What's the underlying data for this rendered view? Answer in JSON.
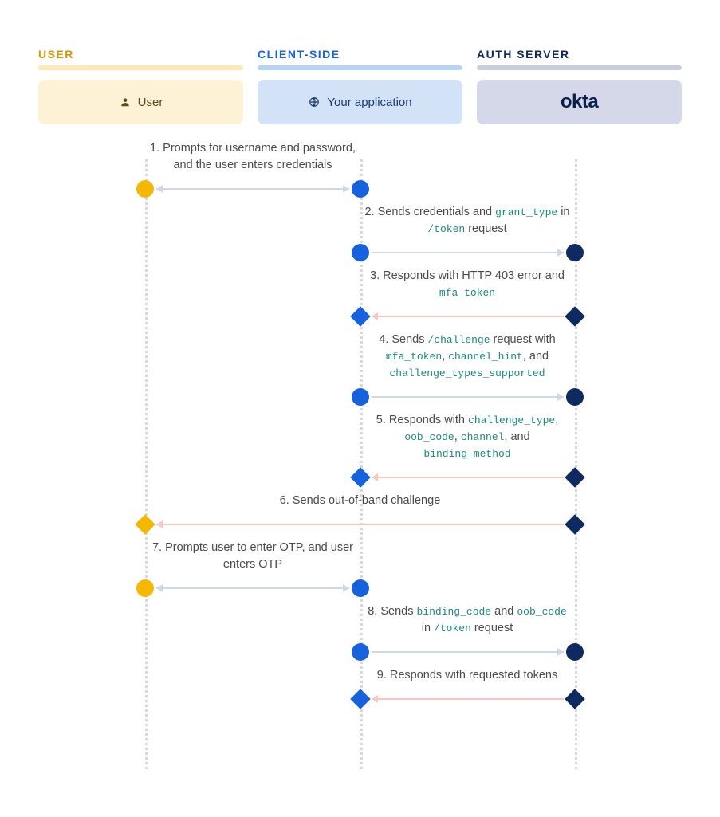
{
  "columns": {
    "user": {
      "header": "USER",
      "box_label": "User"
    },
    "client": {
      "header": "CLIENT-SIDE",
      "box_label": "Your application"
    },
    "server": {
      "header": "AUTH SERVER",
      "box_label": "okta"
    }
  },
  "steps": {
    "s1": {
      "pre": "1. Prompts for username and password, and the user enters credentials"
    },
    "s2": {
      "pre": "2. Sends credentials and ",
      "c1": "grant_type",
      "mid": " in ",
      "c2": "/token",
      "post": " request"
    },
    "s3": {
      "pre": "3. Responds with HTTP 403 error and ",
      "c1": "mfa_token"
    },
    "s4": {
      "pre": "4. Sends ",
      "c1": "/challenge",
      "mid1": " request with ",
      "c2": "mfa_token",
      "mid2": ", ",
      "c3": "channel_hint",
      "mid3": ", and ",
      "c4": "challenge_types_supported"
    },
    "s5": {
      "pre": "5. Responds with ",
      "c1": "challenge_type",
      "mid1": ", ",
      "c2": "oob_code",
      "mid2": ", ",
      "c3": "channel",
      "mid3": ", and ",
      "c4": "binding_method"
    },
    "s6": {
      "pre": "6. Sends out-of-band challenge"
    },
    "s7": {
      "pre": "7. Prompts user to enter OTP, and user enters OTP"
    },
    "s8": {
      "pre": "8. Sends ",
      "c1": "binding_code",
      "mid1": " and ",
      "c2": "oob_code",
      "mid2": " in ",
      "c3": "/token",
      "post": " request"
    },
    "s9": {
      "pre": "9. Responds with requested tokens"
    }
  },
  "chart_data": {
    "type": "sequence-diagram",
    "participants": [
      {
        "id": "user",
        "lane": "USER",
        "label": "User"
      },
      {
        "id": "client",
        "lane": "CLIENT-SIDE",
        "label": "Your application"
      },
      {
        "id": "server",
        "lane": "AUTH SERVER",
        "label": "okta"
      }
    ],
    "messages": [
      {
        "n": 1,
        "from": "client",
        "to": "user",
        "direction": "bidirectional",
        "shape": "circle",
        "text": "Prompts for username and password, and the user enters credentials"
      },
      {
        "n": 2,
        "from": "client",
        "to": "server",
        "direction": "right",
        "shape": "circle",
        "text": "Sends credentials and grant_type in /token request"
      },
      {
        "n": 3,
        "from": "server",
        "to": "client",
        "direction": "left",
        "shape": "diamond",
        "text": "Responds with HTTP 403 error and mfa_token"
      },
      {
        "n": 4,
        "from": "client",
        "to": "server",
        "direction": "right",
        "shape": "circle",
        "text": "Sends /challenge request with mfa_token, channel_hint, and challenge_types_supported"
      },
      {
        "n": 5,
        "from": "server",
        "to": "client",
        "direction": "left",
        "shape": "diamond",
        "text": "Responds with challenge_type, oob_code, channel, and binding_method"
      },
      {
        "n": 6,
        "from": "server",
        "to": "user",
        "direction": "left",
        "shape": "diamond",
        "text": "Sends out-of-band challenge"
      },
      {
        "n": 7,
        "from": "client",
        "to": "user",
        "direction": "bidirectional",
        "shape": "circle",
        "text": "Prompts user to enter OTP, and user enters OTP"
      },
      {
        "n": 8,
        "from": "client",
        "to": "server",
        "direction": "right",
        "shape": "circle",
        "text": "Sends binding_code and oob_code in /token request"
      },
      {
        "n": 9,
        "from": "server",
        "to": "client",
        "direction": "left",
        "shape": "diamond",
        "text": "Responds with requested tokens"
      }
    ]
  }
}
